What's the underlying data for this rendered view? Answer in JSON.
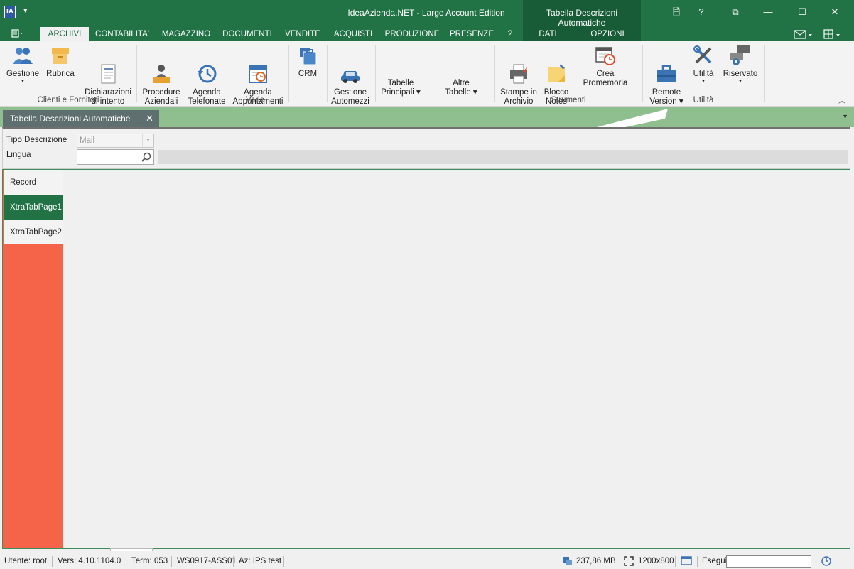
{
  "window": {
    "title": "IdeaAzienda.NET - Large Account Edition",
    "context_title": "Tabella Descrizioni Automatiche",
    "app_icon_text": "IA",
    "buttons": {
      "doc": "🗎",
      "help": "?",
      "restore": "⧉",
      "minimize": "—",
      "maximize": "☐",
      "close": "✕"
    }
  },
  "ribbon_tabs": [
    {
      "label": "ARCHIVI"
    },
    {
      "label": "CONTABILITA'"
    },
    {
      "label": "MAGAZZINO"
    },
    {
      "label": "DOCUMENTI"
    },
    {
      "label": "VENDITE"
    },
    {
      "label": "ACQUISTI"
    },
    {
      "label": "PRODUZIONE"
    },
    {
      "label": "PRESENZE"
    },
    {
      "label": "?"
    },
    {
      "label": "DATI"
    },
    {
      "label": "OPZIONI"
    }
  ],
  "ribbon": {
    "buttons": [
      {
        "label": "Gestione",
        "icon": "users-icon"
      },
      {
        "label": "Rubrica",
        "icon": "box-icon"
      },
      {
        "label": "Dichiarazioni\ndi intento",
        "icon": "document-icon"
      },
      {
        "label": "Procedure\nAziendali",
        "icon": "person-desk-icon"
      },
      {
        "label": "Agenda\nTelefonate",
        "icon": "history-icon"
      },
      {
        "label": "Agenda\nAppuntamenti",
        "icon": "calendar-clock-icon"
      },
      {
        "label": "CRM",
        "icon": "briefcase-stack-icon"
      },
      {
        "label": "Gestione\nAutomezzi",
        "icon": "car-icon"
      },
      {
        "label": "Tabelle\nPrincipali ▾",
        "icon": ""
      },
      {
        "label": "Altre\nTabelle ▾",
        "icon": ""
      },
      {
        "label": "Stampe in\nArchivio",
        "icon": "printer-icon"
      },
      {
        "label": "Blocco\nNotes",
        "icon": "sticky-note-icon"
      },
      {
        "label": "Crea Promemoria",
        "icon": "calendar-alarm-icon"
      },
      {
        "label": "Remote\nVersion ▾",
        "icon": "toolbox-icon"
      },
      {
        "label": "Utilità",
        "icon": "tools-icon"
      },
      {
        "label": "Riservato",
        "icon": "gear-network-icon"
      }
    ],
    "groups": [
      {
        "label": "Clienti e Fornitori"
      },
      {
        "label": "Varie"
      },
      {
        "label": "Strumenti"
      },
      {
        "label": "Utilità"
      }
    ],
    "colors": {
      "accent": "#217346",
      "accent_dark": "#185c37"
    }
  },
  "document_tab": {
    "title": "Tabella Descrizioni Automatiche",
    "close": "✕"
  },
  "form": {
    "tipo_label": "Tipo Descrizione",
    "tipo_value": "Mail",
    "lingua_label": "Lingua",
    "lingua_value": ""
  },
  "side_tabs": [
    {
      "label": "Record"
    },
    {
      "label": "XtraTabPage1"
    },
    {
      "label": "XtraTabPage2"
    }
  ],
  "status": {
    "user": "Utente: root",
    "version": "Vers: 4.10.1104.0",
    "term": "Term: 053",
    "ws": "WS0917-ASS01",
    "az": "Az: IPS test",
    "memory": "237,86 MB",
    "resolution": "1200x800",
    "exec_label": "Esegui"
  }
}
